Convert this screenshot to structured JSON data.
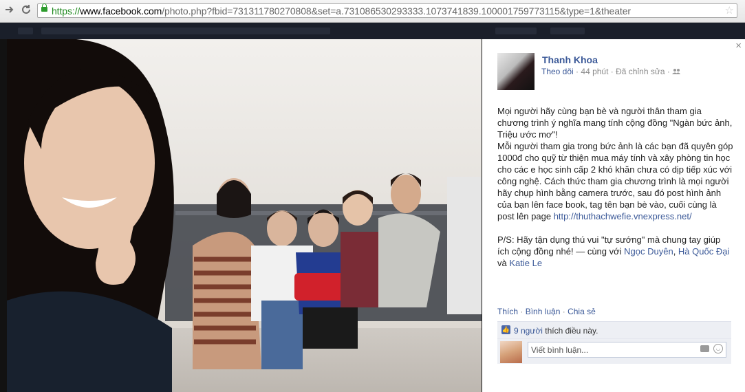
{
  "browser": {
    "url_scheme": "https://",
    "url_host": "www.facebook.com",
    "url_path": "/photo.php?fbid=731311780270808&set=a.731086530293333.1073741839.100001759773115&type=1&theater",
    "back_icon": "arrow-right-icon",
    "reload_icon": "reload-icon",
    "bookmark_icon": "star-icon"
  },
  "post": {
    "author": "Thanh Khoa",
    "follow_label": "Theo dõi",
    "time": "44 phút",
    "edited": "Đã chỉnh sửa",
    "paragraph1": "Mọi người hãy cùng bạn bè và người thân tham gia chương trình ý nghĩa mang tính cộng đồng \"Ngàn bức ảnh, Triệu ước mơ\"!",
    "paragraph2_text": "Mỗi người tham gia trong bức ảnh là các bạn đã quyên góp 1000đ cho quỹ từ thiện mua máy tính và xây phòng tin học cho các e học sinh cấp 2 khó khăn chưa có dịp tiếp xúc với công nghệ. Cách thức tham gia chương trình là mọi người hãy chụp hình bằng camera trước, sau đó post hình ảnh của bạn lên face book, tag tên bạn bè vào, cuối cùng là post lên page ",
    "paragraph2_link": "http://thuthachwefie.vnexpress.net/",
    "paragraph3_text": "P/S: Hãy tận dụng thú vui \"tự sướng\" mà chung tay giúp ích cộng đồng nhé! — cùng với ",
    "tag1": "Ngọc Duyên",
    "tag2": "Hà Quốc Đại",
    "and_word": " và ",
    "tag3": "Katie Le"
  },
  "actions": {
    "like": "Thích",
    "comment": "Bình luận",
    "share": "Chia sẻ",
    "separator": " · "
  },
  "likes": {
    "count_link": "9 người",
    "suffix": " thích điều này."
  },
  "comment_box": {
    "placeholder": "Viết bình luận..."
  },
  "close_label": "×",
  "colors": {
    "fb_blue": "#3b5998",
    "likes_bg": "#edeff4"
  }
}
